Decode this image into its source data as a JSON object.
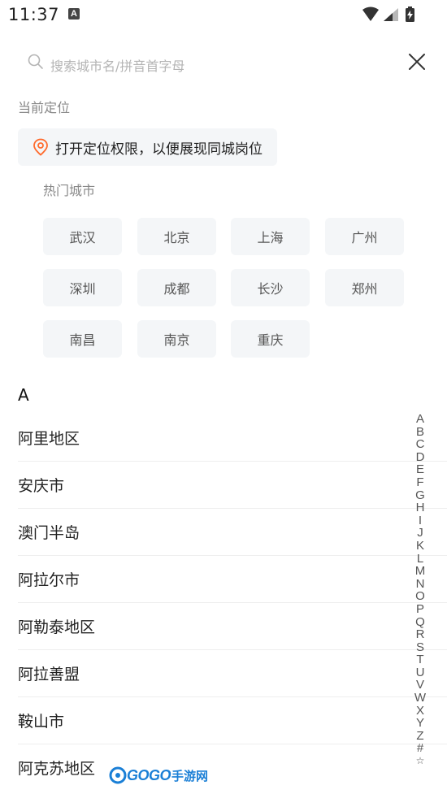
{
  "status_bar": {
    "time": "11:37",
    "notification_letter": "A"
  },
  "search": {
    "placeholder": "搜索城市名/拼音首字母"
  },
  "current_location": {
    "label": "当前定位",
    "chip_text": "打开定位权限，以便展现同城岗位"
  },
  "hot_cities": {
    "label": "热门城市",
    "items": [
      "武汉",
      "北京",
      "上海",
      "广州",
      "深圳",
      "成都",
      "长沙",
      "郑州",
      "南昌",
      "南京",
      "重庆"
    ]
  },
  "city_list": {
    "letter": "A",
    "items": [
      "阿里地区",
      "安庆市",
      "澳门半岛",
      "阿拉尔市",
      "阿勒泰地区",
      "阿拉善盟",
      "鞍山市",
      "阿克苏地区"
    ]
  },
  "index_bar": [
    "A",
    "B",
    "C",
    "D",
    "E",
    "F",
    "G",
    "H",
    "I",
    "J",
    "K",
    "L",
    "M",
    "N",
    "O",
    "P",
    "Q",
    "R",
    "S",
    "T",
    "U",
    "V",
    "W",
    "X",
    "Y",
    "Z",
    "#",
    "☆"
  ],
  "watermark": {
    "logo": "GOGO",
    "text": "手游网"
  },
  "colors": {
    "accent": "#ff6a2c",
    "chip_bg": "#f4f6f8",
    "watermark": "#1a7fd6"
  }
}
